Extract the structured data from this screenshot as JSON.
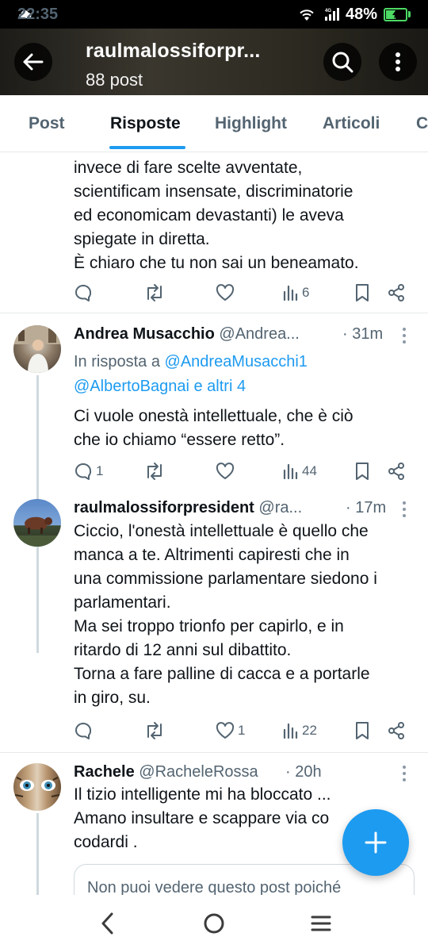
{
  "status_bar": {
    "time": "22:35",
    "battery": "48%",
    "battery_level": 0.48,
    "network": "4G"
  },
  "header": {
    "title": "raulmalossiforpr...",
    "subtitle": "88 post"
  },
  "tabs": [
    {
      "label": "Post",
      "active": false
    },
    {
      "label": "Risposte",
      "active": true
    },
    {
      "label": "Highlight",
      "active": false
    },
    {
      "label": "Articoli",
      "active": false
    },
    {
      "label": "C",
      "active": false
    }
  ],
  "posts": [
    {
      "text_lines": [
        "invece di fare scelte avventate,",
        "scientificam insensate, discriminatorie",
        "ed economicam devastanti) le aveva",
        "spiegate in diretta.",
        "È chiaro che tu non sai un beneamato."
      ],
      "actions": {
        "replies": "",
        "reposts": "",
        "likes": "",
        "views": "6"
      }
    },
    {
      "name": "Andrea Musacchio",
      "handle": "@Andrea...",
      "time": "· 31m",
      "reply_prefix": "In risposta a",
      "reply_to_line1": "@AndreaMusacchi1",
      "reply_to_line2": "@AlbertoBagnai e altri 4",
      "text_lines": [
        "Ci vuole onestà intellettuale, che è ciò",
        "che io chiamo “essere retto”."
      ],
      "actions": {
        "replies": "1",
        "reposts": "",
        "likes": "",
        "views": "44"
      }
    },
    {
      "name": "raulmalossiforpresident",
      "handle": "@ra...",
      "time": "· 17m",
      "text_lines": [
        "Ciccio, l'onestà intellettuale è quello che",
        "manca a te. Altrimenti capiresti che in",
        "una commissione parlamentare siedono i",
        "parlamentari.",
        "Ma sei troppo trionfo per capirlo, e in",
        "ritardo di 12 anni sul dibattito.",
        "Torna a fare palline di cacca e a portarle",
        "in giro, su."
      ],
      "actions": {
        "replies": "",
        "reposts": "",
        "likes": "1",
        "views": "22"
      }
    },
    {
      "name": "Rachele",
      "handle": "@RacheleRossa",
      "time": "· 20h",
      "text_lines": [
        "Il tizio intelligente mi ha bloccato ...",
        "Amano insultare e scappare via co",
        "codardi ."
      ],
      "quote": "Non puoi vedere questo post poiché"
    }
  ],
  "colors": {
    "accent": "#1d9bf0",
    "text": "#0f1419",
    "muted": "#536471",
    "border": "#e7e9ea"
  },
  "icons": [
    "back-arrow-icon",
    "search-icon",
    "more-vertical-icon",
    "reply-icon",
    "repost-icon",
    "like-icon",
    "views-icon",
    "bookmark-icon",
    "share-icon",
    "compose-plus-icon"
  ]
}
